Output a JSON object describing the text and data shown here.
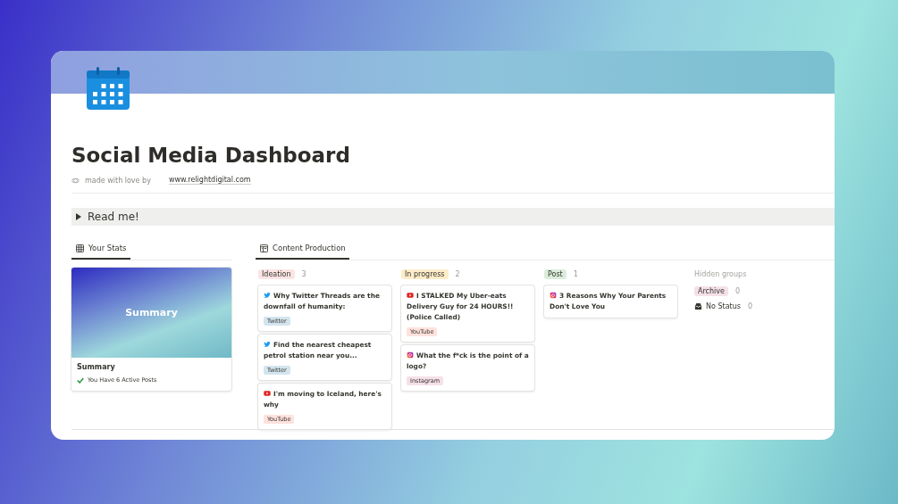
{
  "page": {
    "title": "Social Media Dashboard",
    "byline": "made with love by",
    "link": "www.relightdigital.com"
  },
  "toggle": {
    "label": "Read me!",
    "expanded": false
  },
  "stats": {
    "tab": {
      "label": "Your Stats",
      "selected": true
    },
    "card": {
      "cover": "Summary",
      "title": "Summary",
      "note": "You Have 6 Active Posts"
    }
  },
  "production": {
    "tab": {
      "label": "Content Production",
      "selected": true
    },
    "groups": [
      {
        "label": "Ideation",
        "count": "3",
        "color": "#fbe4e4",
        "cards": [
          {
            "kind": "twitter",
            "title": "Why Twitter Threads are the downfall of humanity:",
            "tag": "Twitter",
            "color": "#d3e5ef"
          },
          {
            "kind": "twitter",
            "title": "Find the nearest cheapest petrol station near you...",
            "tag": "Twitter",
            "color": "#d3e5ef"
          },
          {
            "kind": "youtube",
            "title": "I'm moving to Iceland, here's why",
            "tag": "YouTube",
            "color": "#ffe2dd"
          }
        ]
      },
      {
        "label": "In progress",
        "count": "2",
        "color": "#fdecc8",
        "cards": [
          {
            "kind": "youtube",
            "title": "I STALKED My Uber-eats Delivery Guy for 24 HOURS!! (Police Called)",
            "tag": "YouTube",
            "color": "#ffe2dd"
          },
          {
            "kind": "instagram",
            "title": "What the f*ck is the point of a logo?",
            "tag": "Instagram",
            "color": "#f5e0e9"
          }
        ]
      },
      {
        "label": "Post",
        "count": "1",
        "color": "#dbeddb",
        "cards": [
          {
            "kind": "instagram",
            "title": "3 Reasons Why Your Parents Don't Love You"
          }
        ]
      }
    ],
    "hidden": {
      "heading": "Hidden groups",
      "items": [
        {
          "kind": "tag",
          "label": "Archive",
          "count": "0",
          "color": "#f5e0e9"
        },
        {
          "kind": "inbox",
          "label": "No Status",
          "count": "0"
        }
      ]
    }
  }
}
